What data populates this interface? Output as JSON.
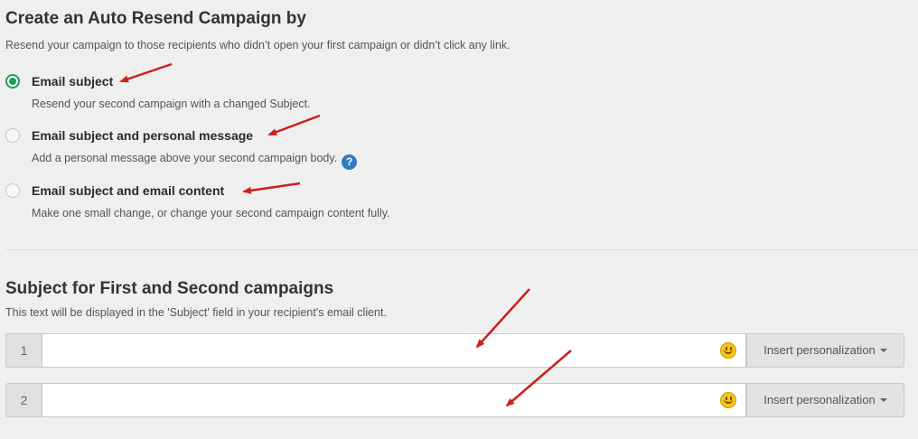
{
  "section_autoresend": {
    "title": "Create an Auto Resend Campaign by",
    "description": "Resend your campaign to those recipients who didn’t open your first campaign or didn’t click any link.",
    "options": [
      {
        "label": "Email subject",
        "description": "Resend your second campaign with a changed Subject.",
        "selected": true
      },
      {
        "label": "Email subject and personal message",
        "description": "Add a personal message above your second campaign body.",
        "selected": false,
        "help_icon": "help-question-icon",
        "help_glyph": "?"
      },
      {
        "label": "Email subject and email content",
        "description": "Make one small change, or change your second campaign content fully.",
        "selected": false
      }
    ]
  },
  "section_subject": {
    "title": "Subject for First and Second campaigns",
    "description": "This text will be displayed in the 'Subject' field in your recipient's email client.",
    "rows": [
      {
        "number": "1",
        "value": "",
        "emoji_icon": "smiley-emoji-icon",
        "insert_label": "Insert personalization"
      },
      {
        "number": "2",
        "value": "",
        "emoji_icon": "smiley-emoji-icon",
        "insert_label": "Insert personalization"
      }
    ]
  },
  "annotations": {
    "arrow_color": "#cc1f1f",
    "arrow_count": 5
  },
  "colors": {
    "radio_selected": "#1e9b5a",
    "help_icon": "#2f7cc1",
    "background": "#efefef"
  }
}
